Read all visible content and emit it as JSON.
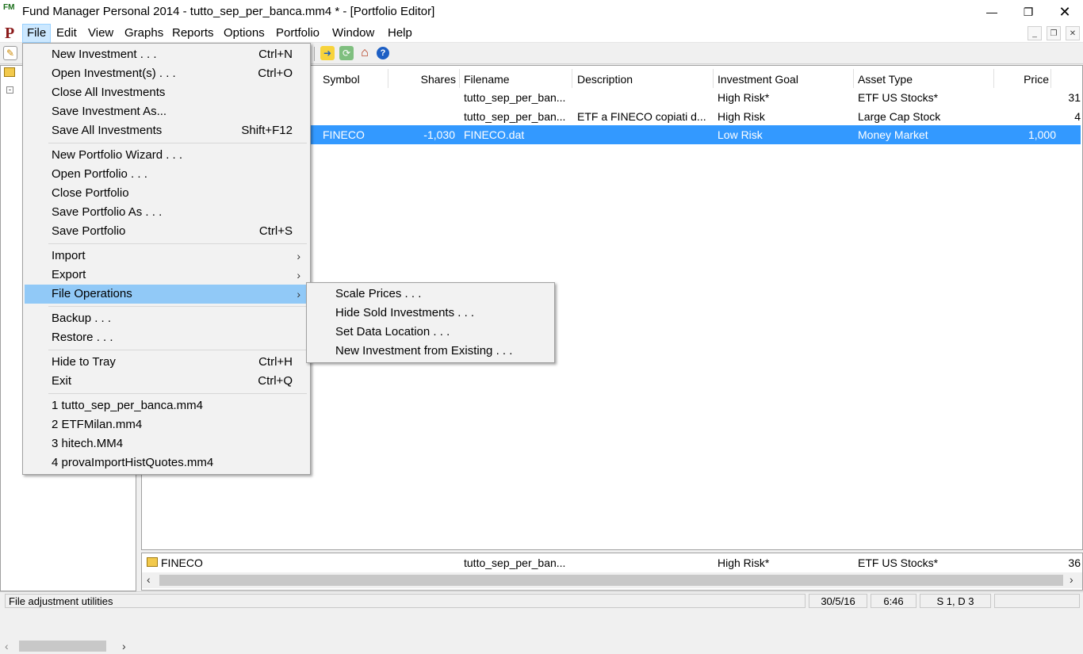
{
  "window": {
    "title": "Fund Manager Personal 2014 - tutto_sep_per_banca.mm4 * - [Portfolio Editor]",
    "app_icon_letters": "FM",
    "mdi_icon_letter": "P"
  },
  "menubar": {
    "items": [
      "File",
      "Edit",
      "View",
      "Graphs",
      "Reports",
      "Options",
      "Portfolio",
      "Window",
      "Help"
    ]
  },
  "grid": {
    "columns": [
      "Symbol",
      "Shares",
      "Filename",
      "Description",
      "Investment Goal",
      "Asset Type",
      "Price"
    ],
    "rows": [
      {
        "symbol": "",
        "shares": "",
        "filename": "tutto_sep_per_ban...",
        "description": "",
        "goal": "High Risk*",
        "asset": "ETF US Stocks*",
        "price": "31"
      },
      {
        "symbol": "",
        "shares": "",
        "filename": "tutto_sep_per_ban...",
        "description": "ETF a FINECO copiati d...",
        "goal": "High Risk",
        "asset": "Large Cap Stock",
        "price": "4"
      },
      {
        "symbol": "FINECO",
        "shares": "-1,030",
        "filename": "FINECO.dat",
        "description": "",
        "goal": "Low Risk",
        "asset": "Money Market",
        "price": "1,000"
      }
    ]
  },
  "summary": {
    "name": "FINECO",
    "filename": "tutto_sep_per_ban...",
    "goal": "High Risk*",
    "asset": "ETF US Stocks*",
    "price": "36"
  },
  "statusbar": {
    "message": "File adjustment utilities",
    "date": "30/5/16",
    "time": "6:46",
    "sd": "S 1, D 3"
  },
  "file_menu": {
    "groups": [
      [
        {
          "label": "New Investment . . .",
          "shortcut": "Ctrl+N"
        },
        {
          "label": "Open Investment(s) . . .",
          "shortcut": "Ctrl+O"
        },
        {
          "label": "Close All Investments",
          "shortcut": ""
        },
        {
          "label": "Save Investment As...",
          "shortcut": ""
        },
        {
          "label": "Save All Investments",
          "shortcut": "Shift+F12"
        }
      ],
      [
        {
          "label": "New Portfolio Wizard . . .",
          "shortcut": ""
        },
        {
          "label": "Open Portfolio . . .",
          "shortcut": ""
        },
        {
          "label": "Close Portfolio",
          "shortcut": ""
        },
        {
          "label": "Save Portfolio As . . .",
          "shortcut": ""
        },
        {
          "label": "Save Portfolio",
          "shortcut": "Ctrl+S"
        }
      ],
      [
        {
          "label": "Import",
          "shortcut": ""
        },
        {
          "label": "Export",
          "shortcut": ""
        },
        {
          "label": "File Operations",
          "shortcut": ""
        }
      ],
      [
        {
          "label": "Backup . . .",
          "shortcut": ""
        },
        {
          "label": "Restore . . .",
          "shortcut": ""
        }
      ],
      [
        {
          "label": "Hide to Tray",
          "shortcut": "Ctrl+H"
        },
        {
          "label": "Exit",
          "shortcut": "Ctrl+Q"
        }
      ],
      [
        {
          "label": "1 tutto_sep_per_banca.mm4",
          "shortcut": ""
        },
        {
          "label": "2 ETFMilan.mm4",
          "shortcut": ""
        },
        {
          "label": "3 hitech.MM4",
          "shortcut": ""
        },
        {
          "label": "4 provaImportHistQuotes.mm4",
          "shortcut": ""
        }
      ]
    ]
  },
  "file_operations_submenu": [
    "Scale Prices . . .",
    "Hide Sold Investments . . .",
    "Set Data Location . . .",
    "New Investment from Existing . . ."
  ],
  "colors": {
    "selection": "#3399ff",
    "menu_highlight": "#91c9f7",
    "menubar_active": "#cce8ff"
  }
}
